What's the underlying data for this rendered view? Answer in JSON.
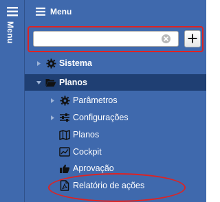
{
  "menu_rail": {
    "title": "Menu"
  },
  "panel": {
    "title": "Menu"
  },
  "search": {
    "placeholder": "",
    "value": ""
  },
  "add_button": {
    "label": "+"
  },
  "tree": [
    {
      "label": "Sistema",
      "icon": "gear-icon",
      "expanded": false,
      "level": 0
    },
    {
      "label": "Planos",
      "icon": "folder-open-icon",
      "expanded": true,
      "level": 0,
      "selected": true
    },
    {
      "label": "Parâmetros",
      "icon": "gear-icon",
      "expanded": false,
      "level": 1
    },
    {
      "label": "Configurações",
      "icon": "sliders-icon",
      "expanded": false,
      "level": 1
    },
    {
      "label": "Planos",
      "icon": "map-icon",
      "level": 1
    },
    {
      "label": "Cockpit",
      "icon": "dashboard-icon",
      "level": 1
    },
    {
      "label": "Aprovação",
      "icon": "thumbs-up-icon",
      "level": 1
    },
    {
      "label": "Relatório de ações",
      "icon": "pdf-icon",
      "level": 1,
      "highlighted": true
    }
  ],
  "colors": {
    "panel_bg": "#3f69ad",
    "selected_row": "#1f3f73",
    "highlight": "#dd2323",
    "text": "#ffffff"
  }
}
